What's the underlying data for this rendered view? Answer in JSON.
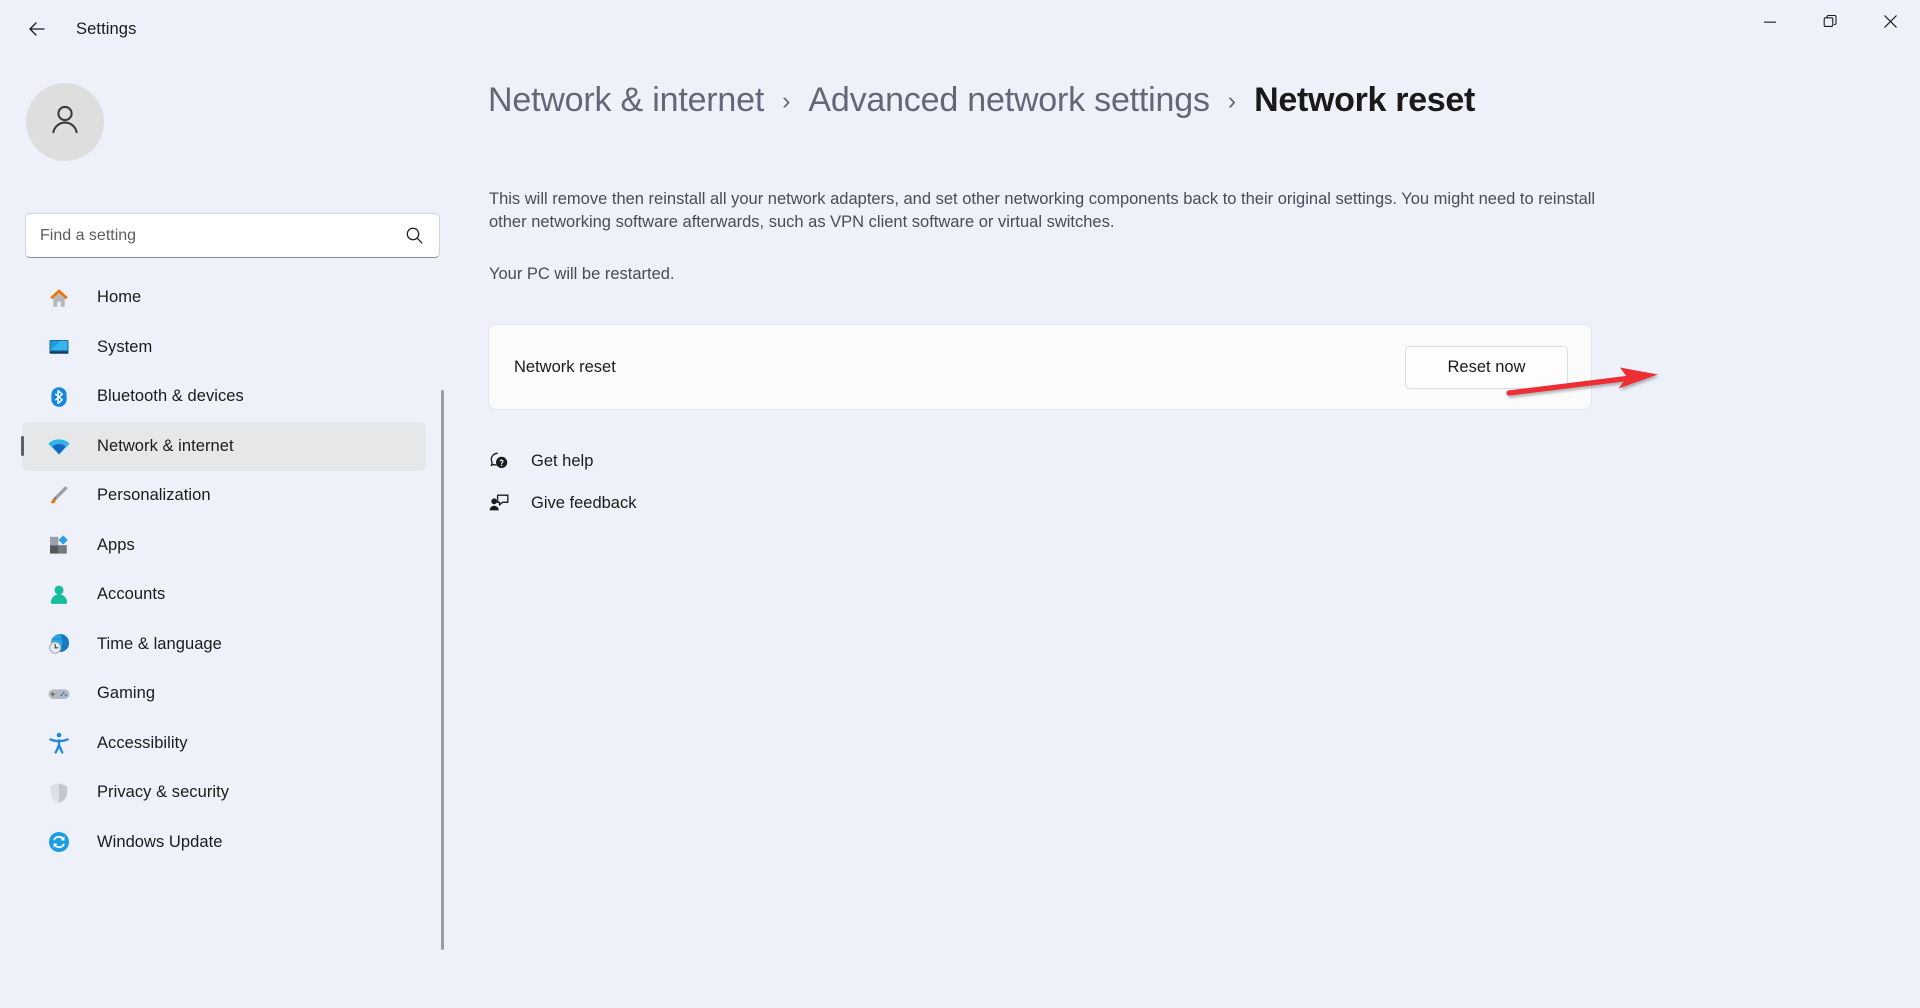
{
  "window": {
    "app_title": "Settings",
    "back_icon": "arrow-left-icon",
    "controls": {
      "minimize": "minimize-icon",
      "maximize": "restore-icon",
      "close": "close-icon"
    }
  },
  "sidebar": {
    "avatar_icon": "person-avatar-icon",
    "search": {
      "placeholder": "Find a setting",
      "value": "",
      "icon": "search-icon"
    },
    "items": [
      {
        "label": "Home",
        "icon": "home-icon",
        "selected": false
      },
      {
        "label": "System",
        "icon": "system-icon",
        "selected": false
      },
      {
        "label": "Bluetooth & devices",
        "icon": "bluetooth-icon",
        "selected": false
      },
      {
        "label": "Network & internet",
        "icon": "wifi-icon",
        "selected": true
      },
      {
        "label": "Personalization",
        "icon": "paintbrush-icon",
        "selected": false
      },
      {
        "label": "Apps",
        "icon": "apps-icon",
        "selected": false
      },
      {
        "label": "Accounts",
        "icon": "accounts-icon",
        "selected": false
      },
      {
        "label": "Time & language",
        "icon": "clock-globe-icon",
        "selected": false
      },
      {
        "label": "Gaming",
        "icon": "gamepad-icon",
        "selected": false
      },
      {
        "label": "Accessibility",
        "icon": "accessibility-icon",
        "selected": false
      },
      {
        "label": "Privacy & security",
        "icon": "shield-icon",
        "selected": false
      },
      {
        "label": "Windows Update",
        "icon": "update-icon",
        "selected": false
      }
    ]
  },
  "main": {
    "breadcrumb": {
      "links": [
        "Network & internet",
        "Advanced network settings"
      ],
      "separator": "›",
      "current": "Network reset"
    },
    "description": "This will remove then reinstall all your network adapters, and set other networking components back to their original settings. You might need to reinstall other networking software afterwards, such as VPN client software or virtual switches.",
    "description_secondary": "Your PC will be restarted.",
    "card": {
      "title": "Network reset",
      "button_label": "Reset now"
    },
    "footer_links": [
      {
        "label": "Get help",
        "icon": "help-bubble-icon"
      },
      {
        "label": "Give feedback",
        "icon": "feedback-person-icon"
      }
    ]
  },
  "annotation": {
    "type": "arrow",
    "color": "#ed2f34",
    "points_to": "Reset now"
  },
  "colors": {
    "page_background": "#eef1fa",
    "card_background": "#fbfbfc",
    "selected_nav_background": "#e5e7e9",
    "accent_blue": "#0f7bd4",
    "annotation_red": "#ed2f34"
  }
}
